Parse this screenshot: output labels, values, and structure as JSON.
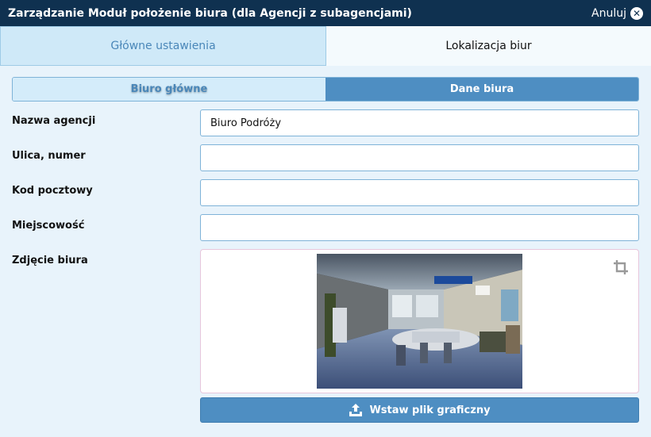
{
  "header": {
    "title": "Zarządzanie Moduł położenie biura (dla Agencji z subagencjami)",
    "cancel_label": "Anuluj"
  },
  "tabs": [
    {
      "label": "Główne ustawienia"
    },
    {
      "label": "Lokalizacja biur"
    }
  ],
  "subtabs": [
    {
      "label": "Biuro główne"
    },
    {
      "label": "Dane biura"
    }
  ],
  "form": {
    "agency_name_label": "Nazwa agencji",
    "agency_name_value": "Biuro Podróży",
    "street_label": "Ulica, numer",
    "street_value": "",
    "postal_label": "Kod pocztowy",
    "postal_value": "",
    "city_label": "Miejscowość",
    "city_value": "",
    "photo_label": "Zdjęcie biura",
    "upload_label": "Wstaw plik graficzny"
  },
  "icons": {
    "cancel": "close-circle-icon",
    "crop": "crop-icon",
    "upload": "upload-icon"
  },
  "colors": {
    "header_bg": "#0f3150",
    "accent": "#4e8ec2",
    "tab_active_text": "#4a87b9",
    "page_bg": "#e8f3fb"
  }
}
